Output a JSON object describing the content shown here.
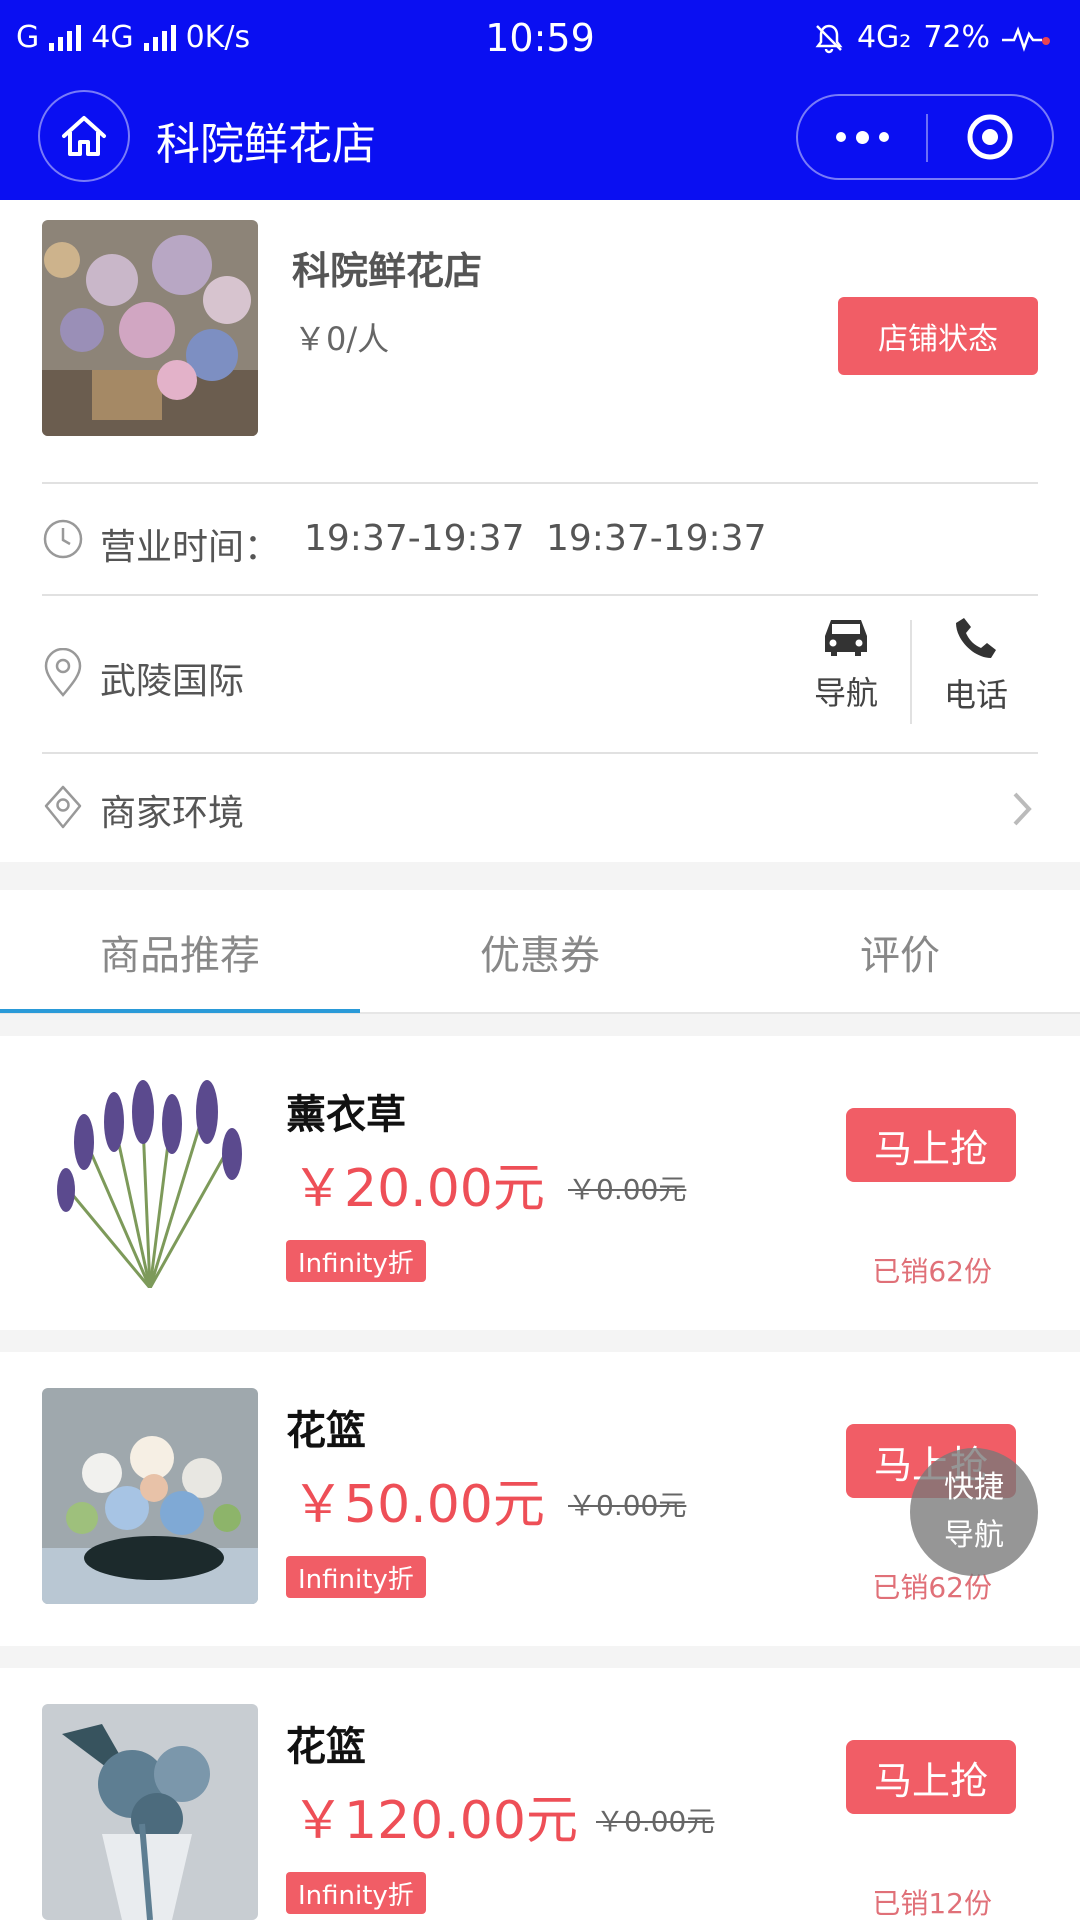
{
  "status_bar": {
    "carrier_left": "G",
    "network": "4G",
    "speed": "0K/s",
    "time": "10:59",
    "network_right": "4G₂",
    "battery": "72%"
  },
  "nav": {
    "title": "科院鲜花店"
  },
  "store": {
    "name": "科院鲜花店",
    "price_per_person": "￥0/人",
    "status_button": "店铺状态",
    "hours_label": "营业时间：",
    "hours_1": "19:37-19:37",
    "hours_2": "19:37-19:37",
    "address": "武陵国际",
    "navigate_label": "导航",
    "phone_label": "电话",
    "environment_label": "商家环境"
  },
  "tabs": [
    {
      "label": "商品推荐",
      "active": true
    },
    {
      "label": "优惠券",
      "active": false
    },
    {
      "label": "评价",
      "active": false
    }
  ],
  "products": [
    {
      "name": "薰衣草",
      "price": "￥20.00元",
      "original": "￥0.00元",
      "discount": "Infinity折",
      "buy": "马上抢",
      "sold": "已销62份"
    },
    {
      "name": "花篮",
      "price": "￥50.00元",
      "original": "￥0.00元",
      "discount": "Infinity折",
      "buy": "马上抢",
      "sold": "已销62份"
    },
    {
      "name": "花篮",
      "price": "￥120.00元",
      "original": "￥0.00元",
      "discount": "Infinity折",
      "buy": "马上抢",
      "sold": "已销12份"
    }
  ],
  "fab": {
    "line1": "快捷",
    "line2": "导航"
  },
  "colors": {
    "header": "#0a0ff2",
    "accent_red": "#f15d66",
    "price_red": "#ee4f57",
    "tab_active": "#2a9ad8"
  }
}
